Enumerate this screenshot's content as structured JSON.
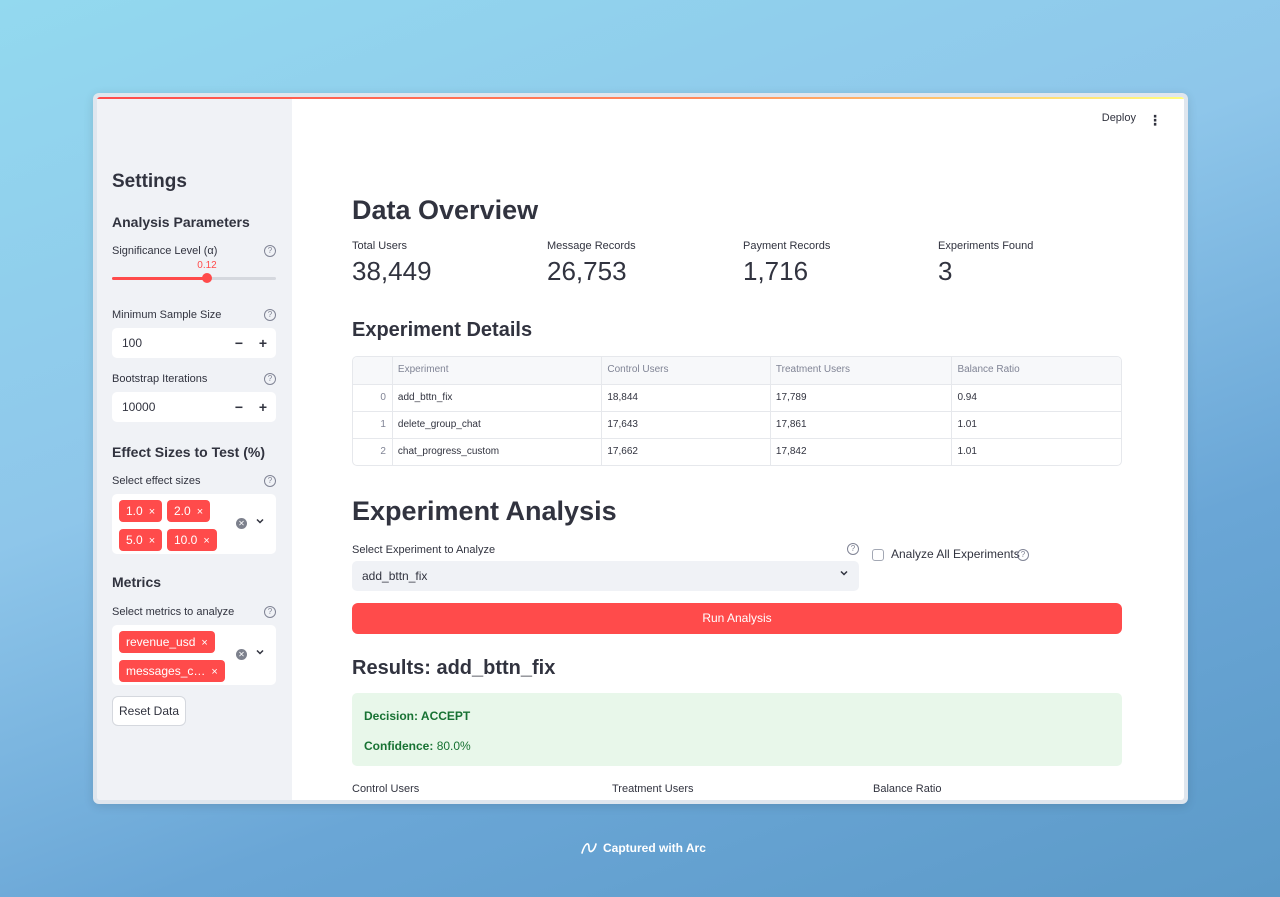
{
  "header": {
    "deploy_label": "Deploy",
    "menu_icon": "kebab-menu-icon"
  },
  "sidebar": {
    "title": "Settings",
    "analysis_parameters": "Analysis Parameters",
    "significance": {
      "label": "Significance Level (α)",
      "value": "0.12",
      "fraction": 0.58
    },
    "min_sample": {
      "label": "Minimum Sample Size",
      "value": "100"
    },
    "bootstrap": {
      "label": "Bootstrap Iterations",
      "value": "10000"
    },
    "effect_title": "Effect Sizes to Test (%)",
    "effect_label": "Select effect sizes",
    "effect_tags": [
      "1.0",
      "2.0",
      "5.0",
      "10.0"
    ],
    "metrics_title": "Metrics",
    "metrics_label": "Select metrics to analyze",
    "metric_tags": [
      "revenue_usd",
      "messages_c…"
    ],
    "reset_label": "Reset Data",
    "minus": "−",
    "plus": "+",
    "tag_remove": "×",
    "help_glyph": "?"
  },
  "overview": {
    "title": "Data Overview",
    "metrics": [
      {
        "label": "Total Users",
        "value": "38,449"
      },
      {
        "label": "Message Records",
        "value": "26,753"
      },
      {
        "label": "Payment Records",
        "value": "1,716"
      },
      {
        "label": "Experiments Found",
        "value": "3"
      }
    ]
  },
  "details": {
    "title": "Experiment Details",
    "columns": [
      "",
      "Experiment",
      "Control Users",
      "Treatment Users",
      "Balance Ratio"
    ],
    "rows": [
      [
        "0",
        "add_bttn_fix",
        "18,844",
        "17,789",
        "0.94"
      ],
      [
        "1",
        "delete_group_chat",
        "17,643",
        "17,861",
        "1.01"
      ],
      [
        "2",
        "chat_progress_custom",
        "17,662",
        "17,842",
        "1.01"
      ]
    ]
  },
  "analysis": {
    "title": "Experiment Analysis",
    "select_label": "Select Experiment to Analyze",
    "selected": "add_bttn_fix",
    "analyze_all": "Analyze All Experiments",
    "run_label": "Run Analysis"
  },
  "results": {
    "title": "Results: add_bttn_fix",
    "decision": "Decision: ACCEPT",
    "confidence_label": "Confidence:",
    "confidence_value": "80.0%",
    "sub_labels": [
      "Control Users",
      "Treatment Users",
      "Balance Ratio"
    ]
  },
  "footer": {
    "captured": "Captured with Arc"
  },
  "colors": {
    "accent": "#ff4b4b",
    "success_bg": "#e8f7ea",
    "success_text": "#177233",
    "sidebar_bg": "#f0f2f6"
  }
}
